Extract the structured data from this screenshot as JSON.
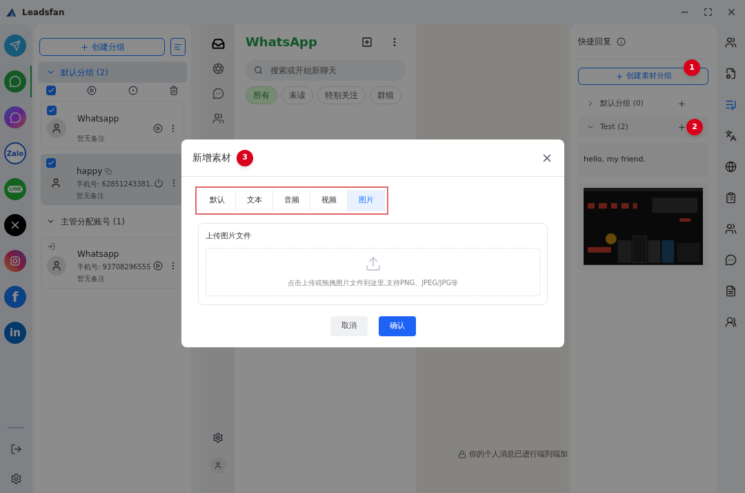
{
  "window": {
    "title": "Leadsfan"
  },
  "apps": [
    {
      "kind": "telegram",
      "selected": false
    },
    {
      "kind": "whatsapp",
      "selected": true
    },
    {
      "kind": "messenger",
      "selected": false
    },
    {
      "kind": "zalo",
      "selected": false,
      "label": "Zalo"
    },
    {
      "kind": "line",
      "selected": false,
      "label": "LINE"
    },
    {
      "kind": "x",
      "selected": false
    },
    {
      "kind": "instagram",
      "selected": false
    },
    {
      "kind": "facebook",
      "selected": false,
      "label": "f"
    },
    {
      "kind": "linkedin",
      "selected": false,
      "label": "in"
    }
  ],
  "accounts_panel": {
    "create_button": "创建分组",
    "groups": [
      {
        "name": "默认分组 (2)",
        "expanded": true,
        "selected": true,
        "toolbar": {
          "checked": true
        },
        "accounts": [
          {
            "kind": "play",
            "name": "Whatsapp",
            "note": "暂无备注",
            "checked": true,
            "selected": false
          },
          {
            "kind": "power",
            "name": "happy",
            "phone": "手机号: 62851243381...",
            "note": "暂无备注",
            "checked": true,
            "selected": true
          }
        ]
      },
      {
        "name": "主管分配账号 (1)",
        "expanded": true,
        "selected": false,
        "accounts": [
          {
            "kind": "play",
            "name": "Whatsapp",
            "phone": "手机号: 93708296555",
            "note": "暂无备注",
            "selected": false
          }
        ]
      }
    ]
  },
  "nav": [
    {
      "kind": "chats",
      "selected": true
    },
    {
      "kind": "status",
      "selected": false
    },
    {
      "kind": "channels",
      "selected": false
    },
    {
      "kind": "communities",
      "selected": false
    }
  ],
  "chat_list": {
    "title": "WhatsApp",
    "search": {
      "placeholder": "搜索或开始新聊天"
    },
    "filters": [
      {
        "label": "所有",
        "selected": true
      },
      {
        "label": "未读",
        "selected": false
      },
      {
        "label": "特别关注",
        "selected": false
      },
      {
        "label": "群组",
        "selected": false
      }
    ]
  },
  "chat_area": {
    "notice": "你的个人消息已进行端到端加"
  },
  "quick_reply": {
    "title": "快捷回复",
    "create_button": {
      "label": "创建素材分组",
      "marker": "1"
    },
    "groups": [
      {
        "name": "默认分组 (0)",
        "expanded": false
      },
      {
        "name": "Test (2)",
        "expanded": true,
        "marker": "2",
        "items": [
          {
            "kind": "text",
            "text": "hello, my friend."
          },
          {
            "kind": "picture"
          }
        ]
      }
    ]
  },
  "tools": [
    {
      "kind": "contacts",
      "selected": false
    },
    {
      "kind": "doc-settings",
      "selected": false
    },
    {
      "kind": "quick-reply",
      "selected": true
    },
    {
      "kind": "translate",
      "selected": false
    },
    {
      "kind": "globe",
      "selected": false
    },
    {
      "kind": "clipboard",
      "selected": false
    },
    {
      "kind": "contacts",
      "selected": false
    },
    {
      "kind": "chat",
      "selected": false
    },
    {
      "kind": "document",
      "selected": false
    },
    {
      "kind": "group",
      "selected": false
    }
  ],
  "dialog": {
    "title": "新增素材",
    "marker": "3",
    "tabs": [
      {
        "label": "默认",
        "selected": false
      },
      {
        "label": "文本",
        "selected": false
      },
      {
        "label": "音频",
        "selected": false
      },
      {
        "label": "视频",
        "selected": false
      },
      {
        "label": "图片",
        "selected": true
      }
    ],
    "upload": {
      "label": "上传图片文件",
      "hint": "点击上传或拖拽图片文件到这里,支持PNG、JPEG/JPG等"
    },
    "buttons": [
      {
        "kind": "cancel",
        "label": "取消"
      },
      {
        "kind": "confirm",
        "label": "确认"
      }
    ]
  }
}
